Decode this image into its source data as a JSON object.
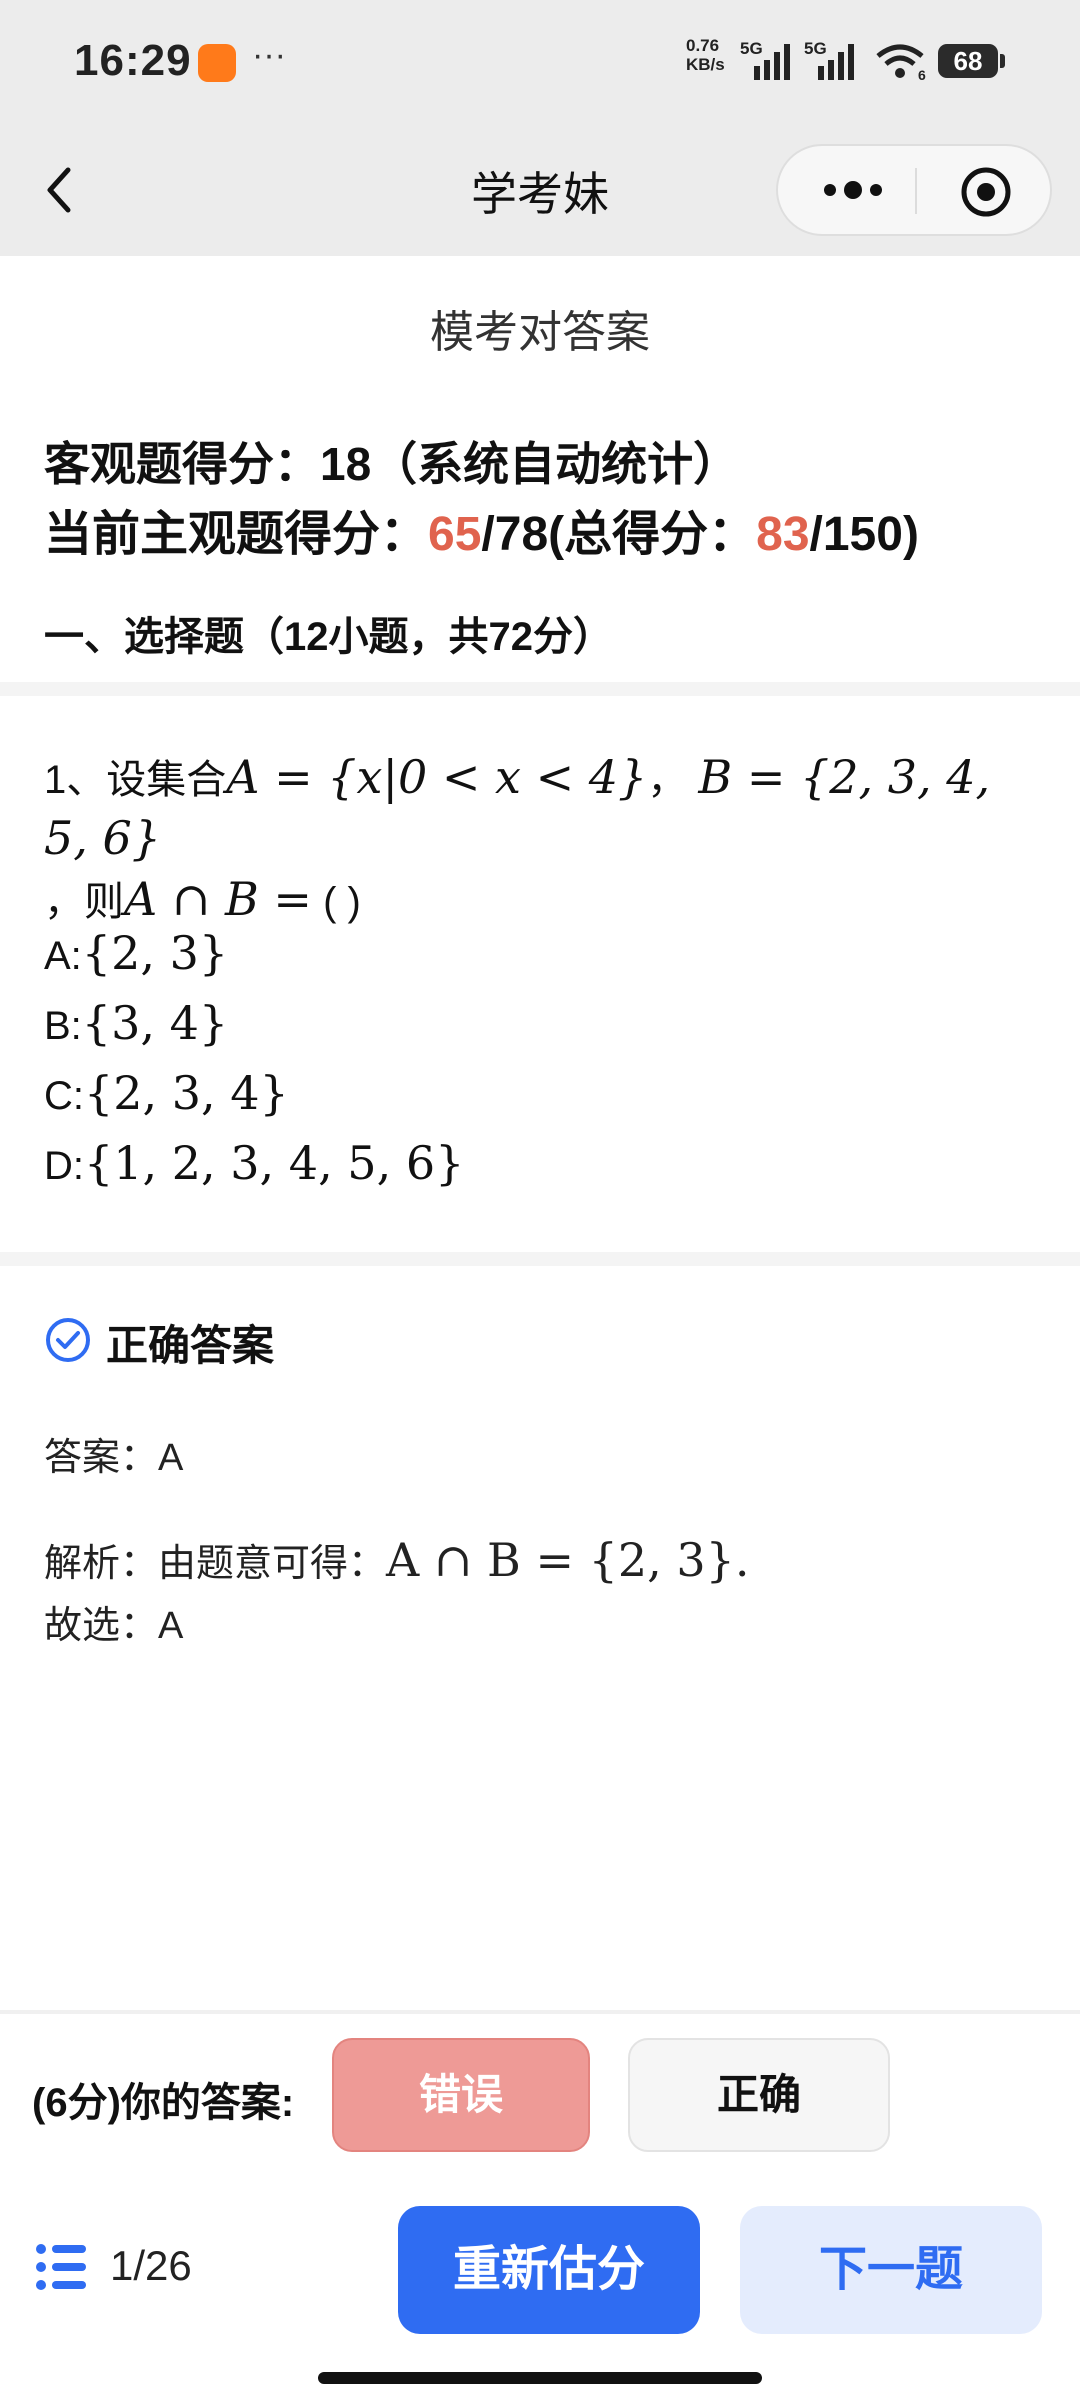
{
  "status_bar": {
    "time": "16:29",
    "net_speed_value": "0.76",
    "net_speed_unit": "KB/s",
    "sim1_label": "5G",
    "sim2_label": "5G",
    "wifi_badge": "6",
    "battery": "68"
  },
  "nav": {
    "title": "学考妹"
  },
  "header": {
    "subtitle": "模考对答案",
    "objective_score_text": "客观题得分：18（系统自动统计）",
    "subjective_prefix": "当前主观题得分：",
    "subjective_score": "65",
    "subjective_mid": "/78(总得分：",
    "total_score": "83",
    "total_suffix": "/150)",
    "score_color": "#e0634e"
  },
  "section": {
    "title": "一、选择题（12小题，共72分）"
  },
  "question": {
    "number_prefix": "1、设集合",
    "set_a": "A = {x|0 < x < 4}",
    "sep": "，",
    "set_b": "B = {2, 3, 4, 5, 6}",
    "line2_prefix": "，则",
    "expr": "A ∩ B =",
    "blank": "(  )"
  },
  "options": [
    {
      "letter": "A:",
      "value": "{2, 3}"
    },
    {
      "letter": "B:",
      "value": "{3, 4}"
    },
    {
      "letter": "C:",
      "value": "{2, 3, 4}"
    },
    {
      "letter": "D:",
      "value": "{1, 2, 3, 4, 5, 6}"
    }
  ],
  "answer": {
    "title": "正确答案",
    "answer_line": "答案：A",
    "analysis_prefix": "解析：由题意可得：",
    "analysis_math": "A ∩ B = {2, 3}.",
    "choose_line": "故选：A"
  },
  "grading": {
    "label": "(6分)你的答案:",
    "wrong_button": "错误",
    "correct_button": "正确"
  },
  "footer": {
    "pager": "1/26",
    "reestimate_button": "重新估分",
    "next_button": "下一题"
  },
  "colors": {
    "accent_blue": "#2f6cf2",
    "wrong_pink": "#ee9a96",
    "highlight_red": "#e0634e"
  }
}
